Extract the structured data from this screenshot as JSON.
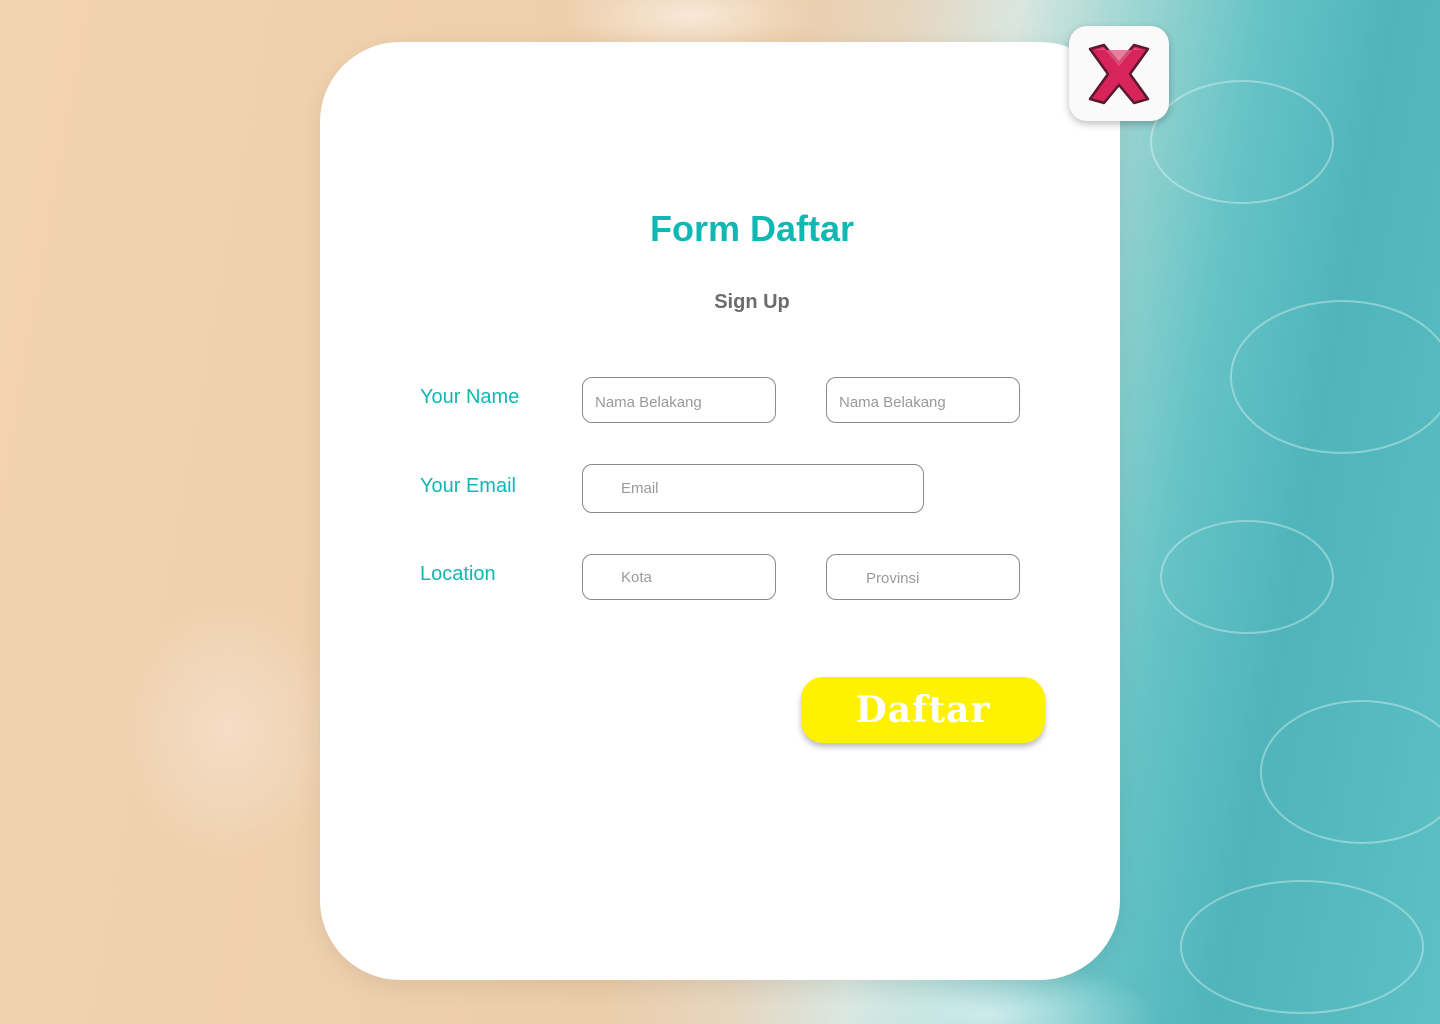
{
  "form": {
    "title": "Form Daftar",
    "subtitle": "Sign Up"
  },
  "fields": {
    "name_label": "Your Name",
    "first_name_placeholder": "Nama Belakang",
    "last_name_placeholder": "Nama Belakang",
    "email_label": "Your Email",
    "email_placeholder": "Email",
    "location_label": "Location",
    "city_placeholder": "Kota",
    "province_placeholder": "Provinsi"
  },
  "actions": {
    "submit_label": "Daftar",
    "close_icon": "close-x-icon"
  },
  "colors": {
    "accent": "#10b7b3",
    "subtitle": "#6c6c6c",
    "button": "#fff200",
    "close_icon": "#d7245a"
  }
}
